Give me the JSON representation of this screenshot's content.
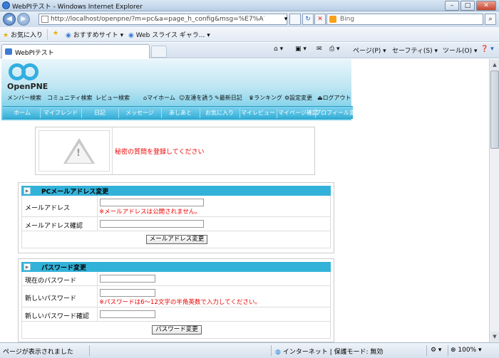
{
  "window": {
    "title": "WebPIテスト - Windows Internet Explorer",
    "btn_min": "–",
    "btn_max": "□",
    "btn_close": "✕"
  },
  "toolbar": {
    "back": "◀",
    "forward": "▶",
    "url": "http://localhost/openpne/?m=pc&a=page_h_config&msg=%E7%A7%98%E5%A",
    "dropdown": "▾",
    "refresh": "↻",
    "stop": "✕",
    "search_placeholder": "Bing",
    "search_go": "⌕"
  },
  "favorites": {
    "label": "お気に入り",
    "items": [
      "おすすめサイト ▾",
      "Web スライス ギャラ... ▾"
    ]
  },
  "tabs": {
    "active_label": "WebPIテスト"
  },
  "commands": {
    "home": "⌂ ▾",
    "feeds": "▣ ▾",
    "mail": "✉",
    "print": "⎙ ▾",
    "page": "ページ(P) ▾",
    "safety": "セーフティ(S) ▾",
    "tools": "ツール(O) ▾",
    "help": "❓ ▾"
  },
  "site": {
    "logo_text": "OpenPNE",
    "search_links": [
      "メンバー検索",
      "コミュニティ検索",
      "レビュー検索"
    ],
    "utility_links": [
      "マイホーム",
      "友達を誘う",
      "最新日記",
      "ランキング",
      "設定変更",
      "ログアウト"
    ],
    "global_nav": [
      "ホーム",
      "マイフレンド",
      "日記",
      "メッセージ",
      "あしあと",
      "お気に入り",
      "マイレビュー",
      "マイページ確認",
      "プロフィール変更"
    ]
  },
  "notice": {
    "mark": "!",
    "message": "秘密の質問を登録してください"
  },
  "email_form": {
    "arrow": "▶",
    "title": "PCメールアドレス変更",
    "email_label": "メールアドレス",
    "email_note": "※メールアドレスは公開されません。",
    "confirm_label": "メールアドレス確認",
    "submit": "メールアドレス変更"
  },
  "password_form": {
    "arrow": "▶",
    "title": "パスワード変更",
    "current_label": "現在のパスワード",
    "new_label": "新しいパスワード",
    "new_note": "※パスワードは6～12文字の半角英数で入力してください。",
    "confirm_label": "新しいパスワード確認",
    "submit": "パスワード変更"
  },
  "scroll": {
    "up": "▲",
    "down": "▼"
  },
  "status": {
    "text": "ページが表示されました",
    "zone": "インターネット | 保護モード: 無効",
    "zoom": "100%",
    "zoom_menu": "▾"
  }
}
